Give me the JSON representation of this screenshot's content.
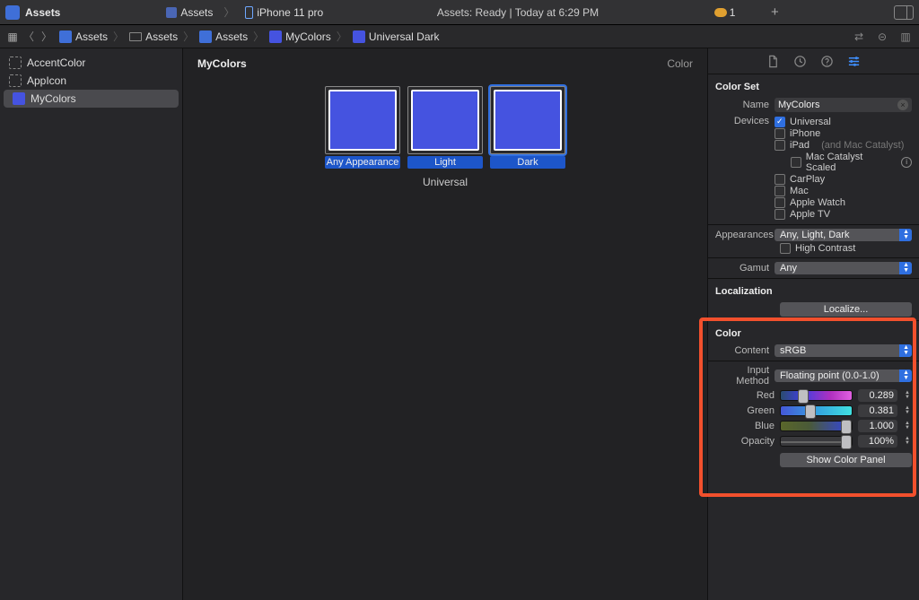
{
  "titlebar": {
    "app_name": "Assets",
    "scheme": "Assets",
    "device": "iPhone 11 pro",
    "status": "Assets: Ready | Today at 6:29 PM",
    "cloud_count": "1"
  },
  "breadcrumb": {
    "items": [
      "Assets",
      "Assets",
      "Assets",
      "MyColors",
      "Universal Dark"
    ]
  },
  "sidebar": {
    "items": [
      {
        "label": "AccentColor",
        "icon": "dotted"
      },
      {
        "label": "AppIcon",
        "icon": "dotted"
      },
      {
        "label": "MyColors",
        "icon": "color",
        "selected": true
      }
    ]
  },
  "editor": {
    "title": "MyColors",
    "type_label": "Color",
    "swatches": [
      {
        "label": "Any Appearance"
      },
      {
        "label": "Light"
      },
      {
        "label": "Dark",
        "selected": true
      }
    ],
    "group_label": "Universal"
  },
  "inspector": {
    "section1_title": "Color Set",
    "name_label": "Name",
    "name_value": "MyColors",
    "devices_label": "Devices",
    "devices": [
      {
        "label": "Universal",
        "checked": true
      },
      {
        "label": "iPhone",
        "checked": false
      },
      {
        "label": "iPad",
        "checked": false,
        "suffix": "(and Mac Catalyst)"
      },
      {
        "label": "Mac Catalyst Scaled",
        "checked": false,
        "sub": true,
        "info": true
      },
      {
        "label": "CarPlay",
        "checked": false
      },
      {
        "label": "Mac",
        "checked": false
      },
      {
        "label": "Apple Watch",
        "checked": false
      },
      {
        "label": "Apple TV",
        "checked": false
      }
    ],
    "appearances_label": "Appearances",
    "appearances_value": "Any, Light, Dark",
    "high_contrast_label": "High Contrast",
    "gamut_label": "Gamut",
    "gamut_value": "Any",
    "localization_title": "Localization",
    "localize_button": "Localize...",
    "color_title": "Color",
    "content_label": "Content",
    "content_value": "sRGB",
    "input_method_label": "Input Method",
    "input_method_value": "Floating point (0.0-1.0)",
    "red_label": "Red",
    "red_value": "0.289",
    "green_label": "Green",
    "green_value": "0.381",
    "blue_label": "Blue",
    "blue_value": "1.000",
    "opacity_label": "Opacity",
    "opacity_value": "100%",
    "show_panel_button": "Show Color Panel"
  }
}
